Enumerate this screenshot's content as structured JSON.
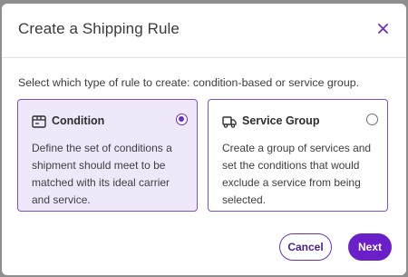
{
  "modal": {
    "title": "Create a Shipping Rule",
    "close_icon": "close-icon",
    "intro": "Select which type of rule to create: condition-based or service group."
  },
  "options": [
    {
      "title": "Condition",
      "icon": "shipment-box-icon",
      "description": "Define the set of conditions a shipment should meet to be matched with its ideal carrier and service.",
      "selected": true
    },
    {
      "title": "Service Group",
      "icon": "truck-icon",
      "description": "Create a group of services and set the conditions that would exclude a service from being selected.",
      "selected": false
    }
  ],
  "footer": {
    "cancel_label": "Cancel",
    "next_label": "Next"
  },
  "colors": {
    "accent": "#6b2fc4",
    "selected_bg": "#efe8fb",
    "backdrop": "#8e8e8e"
  }
}
